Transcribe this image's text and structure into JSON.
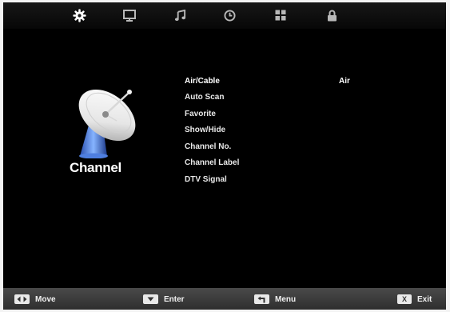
{
  "tabs": [
    {
      "icon": "gear-icon",
      "active": true
    },
    {
      "icon": "monitor-icon",
      "active": false
    },
    {
      "icon": "music-note-icon",
      "active": false
    },
    {
      "icon": "clock-icon",
      "active": false
    },
    {
      "icon": "grid-icon",
      "active": false
    },
    {
      "icon": "lock-icon",
      "active": false
    }
  ],
  "page": {
    "title": "Channel",
    "logo_icon": "satellite-dish-icon"
  },
  "menu": {
    "items": [
      {
        "label": "Air/Cable",
        "value": "Air",
        "selected": true
      },
      {
        "label": "Auto Scan",
        "selected": false
      },
      {
        "label": "Favorite",
        "selected": false
      },
      {
        "label": "Show/Hide",
        "selected": false
      },
      {
        "label": "Channel No.",
        "selected": false
      },
      {
        "label": "Channel Label",
        "selected": false
      },
      {
        "label": "DTV Signal",
        "selected": false
      }
    ]
  },
  "footer": {
    "hints": [
      {
        "icon": "left-right-arrows-icon",
        "label": "Move"
      },
      {
        "icon": "enter-icon",
        "label": "Enter"
      },
      {
        "icon": "return-icon",
        "label": "Menu"
      },
      {
        "icon": "exit-key-icon",
        "key": "X",
        "label": "Exit"
      }
    ]
  },
  "colors": {
    "background": "#000000",
    "tab_active": "#ffffff",
    "tab_inactive": "#b8b8b8",
    "footer_bar": "#3f3f3f",
    "text": "#ffffff"
  }
}
